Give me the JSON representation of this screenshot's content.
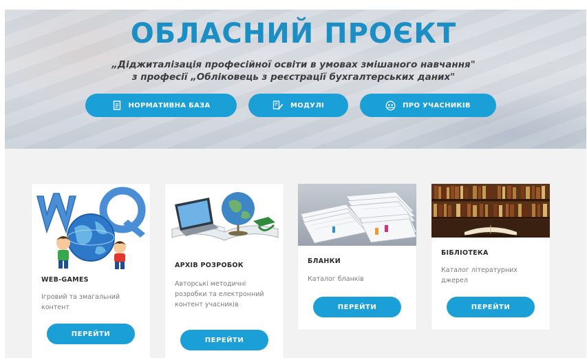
{
  "hero": {
    "title": "ОБЛАСНИЙ ПРОЄКТ",
    "subtitle_line1": "„Діджиталізація професійної освіти в умовах змішаного навчання\"",
    "subtitle_line2": "з професії „Обліковець з реєстрації бухгалтерських даних\"",
    "buttons": [
      {
        "label": "НОРМАТИВНА БАЗА",
        "icon": "document-icon"
      },
      {
        "label": "МОДУЛІ",
        "icon": "edit-document-icon"
      },
      {
        "label": "ПРО УЧАСНИКІВ",
        "icon": "participants-icon"
      }
    ]
  },
  "cards": [
    {
      "title": "WEB-GAMES",
      "description": "Ігровий та змагальний контент",
      "button": "ПЕРЕЙТИ",
      "image": "wq-kids-globe-image"
    },
    {
      "title": "АРХІВ РОЗРОБОК",
      "description": "Авторські методичні розробки та електронний контент учасників",
      "button": "ПЕРЕЙТИ",
      "image": "laptop-globe-books-image"
    },
    {
      "title": "БЛАНКИ",
      "description": "Каталог бланків",
      "button": "ПЕРЕЙТИ",
      "image": "paper-stacks-image"
    },
    {
      "title": "БІБЛІОТЕКА",
      "description": "Каталог літературних джерел",
      "button": "ПЕРЕЙТИ",
      "image": "library-shelves-image"
    }
  ],
  "colors": {
    "accent": "#1a9fd7",
    "title": "#1b8fc4",
    "section_bg": "#f2f2f2"
  }
}
